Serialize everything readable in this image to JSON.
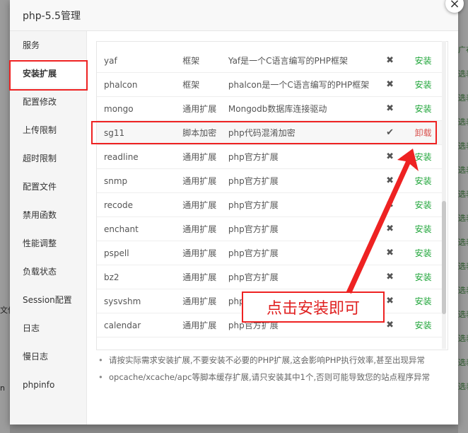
{
  "dialog": {
    "title": "php-5.5管理",
    "close_icon": "×"
  },
  "sidebar": {
    "items": [
      {
        "label": "服务"
      },
      {
        "label": "安装扩展"
      },
      {
        "label": "配置修改"
      },
      {
        "label": "上传限制"
      },
      {
        "label": "超时限制"
      },
      {
        "label": "配置文件"
      },
      {
        "label": "禁用函数"
      },
      {
        "label": "性能调整"
      },
      {
        "label": "负载状态"
      },
      {
        "label": "Session配置"
      },
      {
        "label": "日志"
      },
      {
        "label": "慢日志"
      },
      {
        "label": "phpinfo"
      }
    ]
  },
  "extensions": [
    {
      "name": "yaf",
      "type": "框架",
      "desc": "Yaf是一个C语言编写的PHP框架",
      "status_icon": "✖",
      "action": "安装"
    },
    {
      "name": "phalcon",
      "type": "框架",
      "desc": "phalcon是一个C语言编写的PHP框架",
      "status_icon": "✖",
      "action": "安装"
    },
    {
      "name": "mongo",
      "type": "通用扩展",
      "desc": "Mongodb数据库连接驱动",
      "status_icon": "✖",
      "action": "安装"
    },
    {
      "name": "sg11",
      "type": "脚本加密",
      "desc": "php代码混淆加密",
      "status_icon": "✔",
      "action": "卸载"
    },
    {
      "name": "readline",
      "type": "通用扩展",
      "desc": "php官方扩展",
      "status_icon": "✖",
      "action": "安装"
    },
    {
      "name": "snmp",
      "type": "通用扩展",
      "desc": "php官方扩展",
      "status_icon": "✖",
      "action": "安装"
    },
    {
      "name": "recode",
      "type": "通用扩展",
      "desc": "php官方扩展",
      "status_icon": "✖",
      "action": "安装"
    },
    {
      "name": "enchant",
      "type": "通用扩展",
      "desc": "php官方扩展",
      "status_icon": "✖",
      "action": "安装"
    },
    {
      "name": "pspell",
      "type": "通用扩展",
      "desc": "php官方扩展",
      "status_icon": "✖",
      "action": "安装"
    },
    {
      "name": "bz2",
      "type": "通用扩展",
      "desc": "php官方扩展",
      "status_icon": "✖",
      "action": "安装"
    },
    {
      "name": "sysvshm",
      "type": "通用扩展",
      "desc": "php官方扩展",
      "status_icon": "✖",
      "action": "安装"
    },
    {
      "name": "calendar",
      "type": "通用扩展",
      "desc": "php官方扩展",
      "status_icon": "✖",
      "action": "安装"
    }
  ],
  "notes": [
    "请按实际需求安装扩展,不要安装不必要的PHP扩展,这会影响PHP执行效率,甚至出现异常",
    "opcache/xcache/apc等脚本缓存扩展,请只安装其中1个,否则可能导致您的站点程序异常"
  ],
  "annotation": {
    "text": "点击安装即可"
  },
  "background": {
    "right_fragments": [
      "广布",
      "选表",
      "选表",
      "选表",
      "选表",
      "选表",
      "选表",
      "选表",
      "选表",
      "选表",
      "选表",
      "选表",
      "选表",
      "选表",
      "选表"
    ],
    "left_fragments": [
      "文件",
      "n"
    ]
  },
  "colors": {
    "install": "#20a53a",
    "uninstall": "#d9534f",
    "annotation": "#e22222"
  }
}
